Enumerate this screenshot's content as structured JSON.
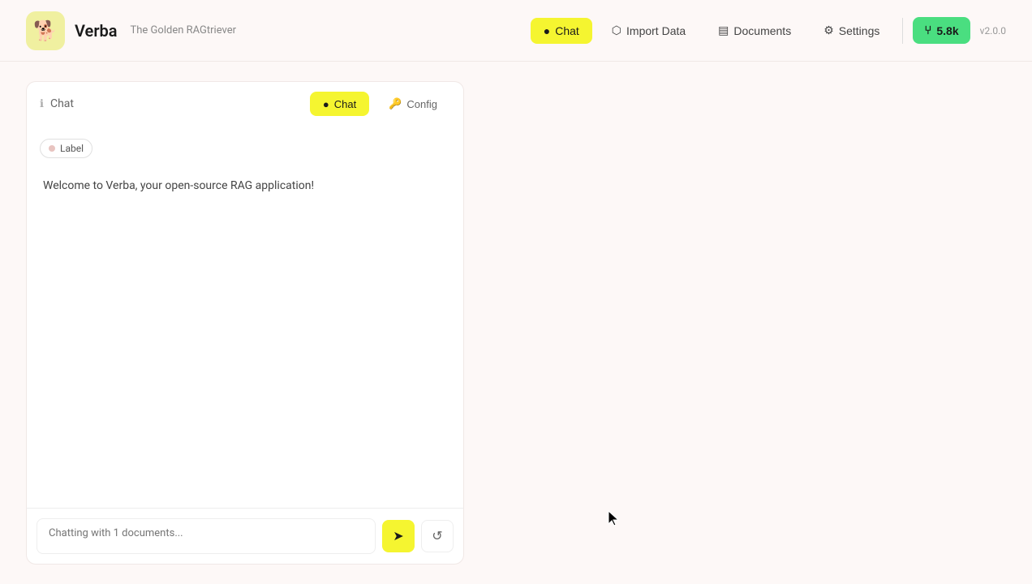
{
  "header": {
    "logo_emoji": "🐕",
    "app_name": "Verba",
    "app_subtitle": "The Golden RAGtriever",
    "nav": {
      "chat_label": "Chat",
      "import_data_label": "Import Data",
      "documents_label": "Documents",
      "settings_label": "Settings",
      "github_stars": "5.8k",
      "version": "v2.0.0"
    }
  },
  "chat_panel": {
    "title": "Chat",
    "title_icon": "ℹ",
    "tabs": {
      "chat_label": "Chat",
      "config_label": "Config"
    },
    "label_tag": "Label",
    "welcome_message": "Welcome to Verba, your open-source RAG application!",
    "input_placeholder": "Chatting with 1 documents...",
    "send_icon": "➤",
    "reset_icon": "↺"
  }
}
